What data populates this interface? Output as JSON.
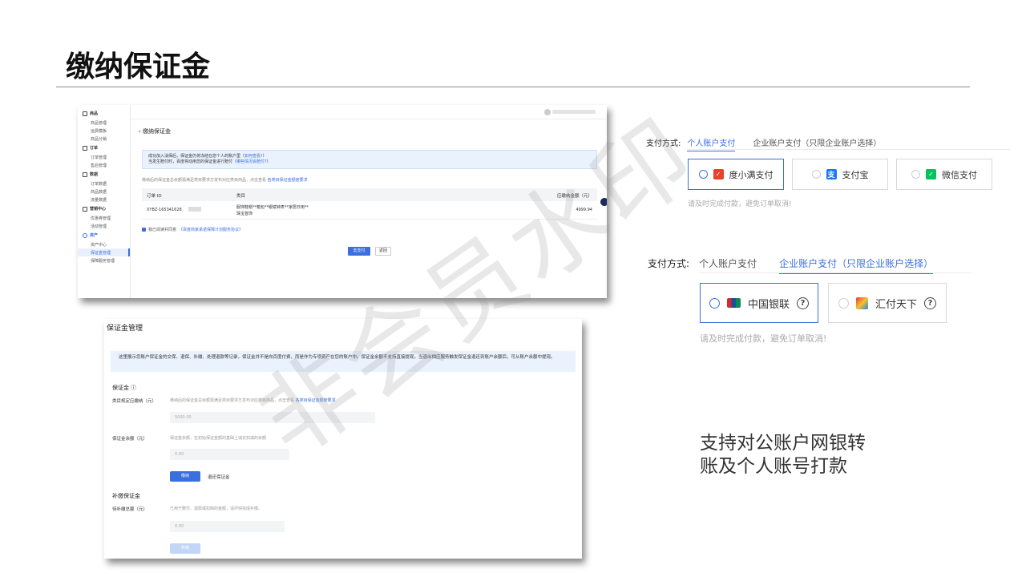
{
  "slide": {
    "title": "缴纳保证金",
    "summary": "支持对公账户网银转\n账及个人账号打款",
    "watermark": "非会员水印"
  },
  "shot1": {
    "sidebar": [
      {
        "group": "商品",
        "items": [
          "商品管理",
          "运费模板",
          "商品分销"
        ]
      },
      {
        "group": "订单",
        "items": [
          "订单管理",
          "售后管理"
        ]
      },
      {
        "group": "数据",
        "items": [
          "订单数据",
          "商品数据",
          "流量数据"
        ]
      },
      {
        "group": "营销中心",
        "items": [
          "优惠券管理",
          "活动管理"
        ]
      },
      {
        "group": "资产",
        "items": [
          "资产中心",
          "保证金管理",
          "保障服务管理"
        ],
        "active_item": "保证金管理"
      }
    ],
    "back_title": "缴纳保证金",
    "notice_line1": "成功加入消保后，保证金仍将冻结在您个人的账户里（",
    "notice_link1": "如何查看?",
    "notice_line1_end": "）",
    "notice_line2": "当发生赔付时，百度将动用您的保证金进行赔付（",
    "notice_link2": "哪些情况会赔付?",
    "notice_line2_end": "）",
    "requirement": "缴纳后的保证金总余额需满足类目要求方发布对应类目商品，点击查看",
    "requirement_link": "各类目保证金额度要求",
    "table": {
      "headers": [
        "订单 ID",
        "类目",
        "应缴纳金额（元）"
      ],
      "row": {
        "order_id": "XYBZ-165341628",
        "category_line1": "服饰鞋帽**箱包**眼镜钟表**家居日用**",
        "category_line2": "珠宝首饰",
        "amount": "4999.94"
      }
    },
    "agree_text": "我已阅读并同意",
    "agree_link": "《百度商家承诺保障计划服务协议》",
    "pay_button": "去支付",
    "back_button": "返回"
  },
  "shot2": {
    "title": "保证金管理",
    "notice": "这里展示您账户保证金的交保、退保、补缴、处理退款等记录，保证金并不是向百度付费，而是作为专项资产在您的账户中。保证金余额不支持直接提现，当退出相应服务触发保证金退还到账户余额后，可从账户余额中提现。",
    "section1": "保证金 ⓘ",
    "row1_label": "类目规定应缴纳（元）",
    "row1_desc": "缴纳后的保证金总余额需满足类目要求方发布对应类目商品，点击查看",
    "row1_link": "各类目保证金额度要求",
    "row1_value": "5000.00",
    "row2_label": "保证金余额（元）",
    "row2_desc": "保证金余额，在初始保证金额的基础上减去扣减的余额",
    "row2_value": "0.00",
    "pay_button": "缴纳",
    "refund_link": "退还保证金",
    "section2": "补缴保证金",
    "row3_label": "待补缴总额（元）",
    "row3_desc": "已用于赔付、退款或扣除的金额，请尽快完成补缴。",
    "row3_value": "0.00",
    "repay_button": "补缴"
  },
  "pay1": {
    "label": "支付方式:",
    "tab_personal": "个人账户支付",
    "tab_company": "企业账户支付（只限企业账户选择）",
    "options": [
      "度小满支付",
      "支付宝",
      "微信支付"
    ],
    "hint": "请及时完成付款，避免订单取消!"
  },
  "pay2": {
    "label": "支付方式:",
    "tab_personal": "个人账户支付",
    "tab_company": "企业账户支付（只限企业账户选择）",
    "options": [
      "中国银联",
      "汇付天下"
    ],
    "hint": "请及时完成付款，避免订单取消!"
  },
  "colors": {
    "accent": "#3b6fe0",
    "duxiaoman": "#e8412c",
    "alipay": "#1677ff",
    "wechat": "#07c160"
  }
}
